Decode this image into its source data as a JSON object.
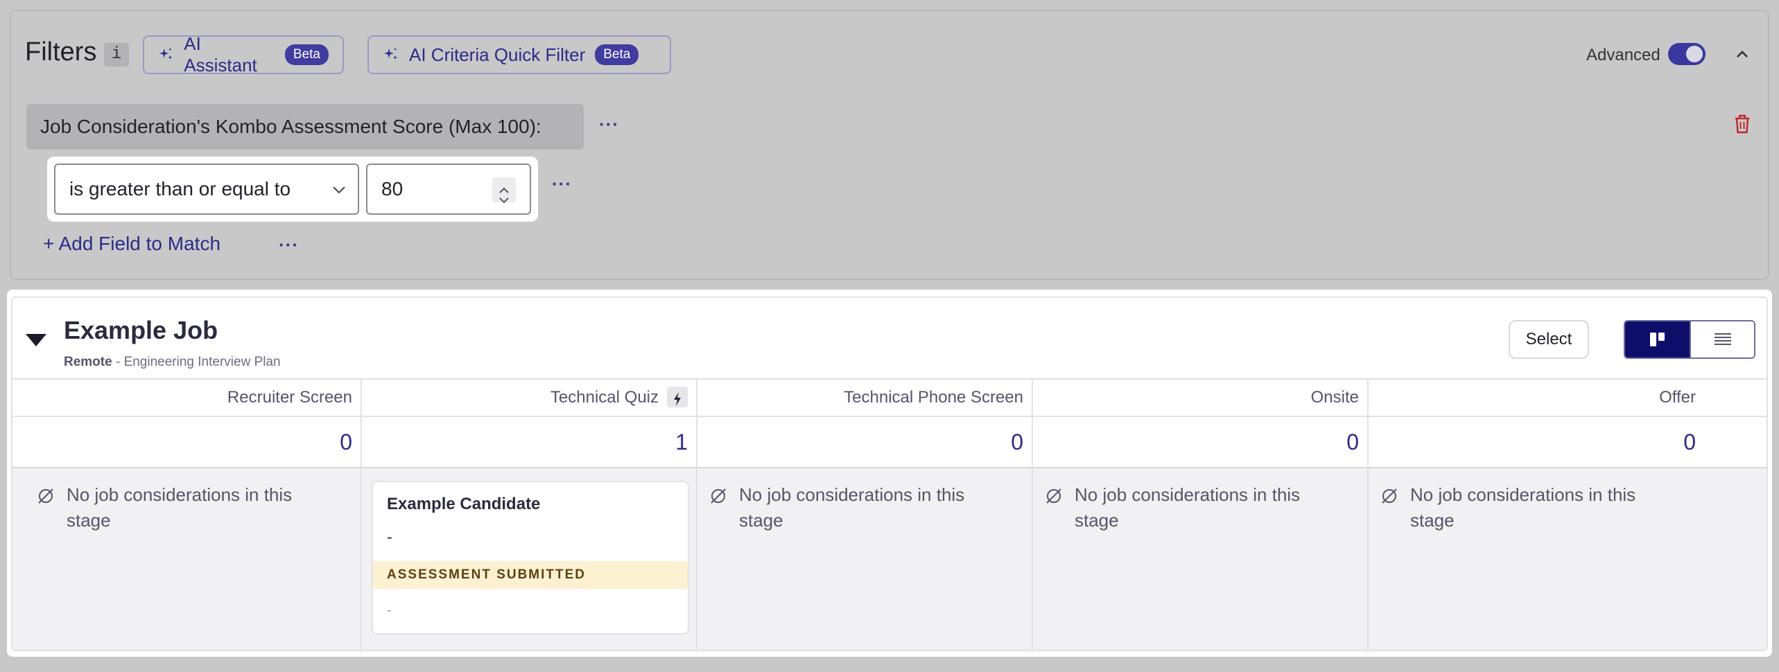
{
  "filters": {
    "title": "Filters",
    "info_label": "i",
    "ai_assistant": {
      "label": "AI Assistant",
      "badge": "Beta"
    },
    "ai_criteria": {
      "label": "AI Criteria Quick Filter",
      "badge": "Beta"
    },
    "advanced_label": "Advanced",
    "advanced_on": true,
    "field_label": "Job Consideration's Kombo Assessment Score (Max 100):",
    "more_label": "···",
    "operator": "is greater than or equal to",
    "value": "80",
    "add_field_label": "+ Add Field to Match"
  },
  "job": {
    "title": "Example Job",
    "location": "Remote",
    "subtitle": " - Engineering Interview Plan",
    "select_label": "Select",
    "empty_message": "No job considerations in this stage",
    "stages": [
      {
        "name": "Recruiter Screen",
        "count": "0"
      },
      {
        "name": "Technical Quiz",
        "count": "1"
      },
      {
        "name": "Technical Phone Screen",
        "count": "0"
      },
      {
        "name": "Onsite",
        "count": "0"
      },
      {
        "name": "Offer",
        "count": "0"
      }
    ],
    "candidate": {
      "name": "Example Candidate",
      "detail": "-",
      "status": "ASSESSMENT SUBMITTED",
      "footer": "-"
    }
  },
  "colors": {
    "accent": "#2d2a8a",
    "badge": "#403ca0",
    "active_view": "#0e0e6a",
    "status_bg": "#fcf1d1",
    "danger": "#c0262d"
  }
}
